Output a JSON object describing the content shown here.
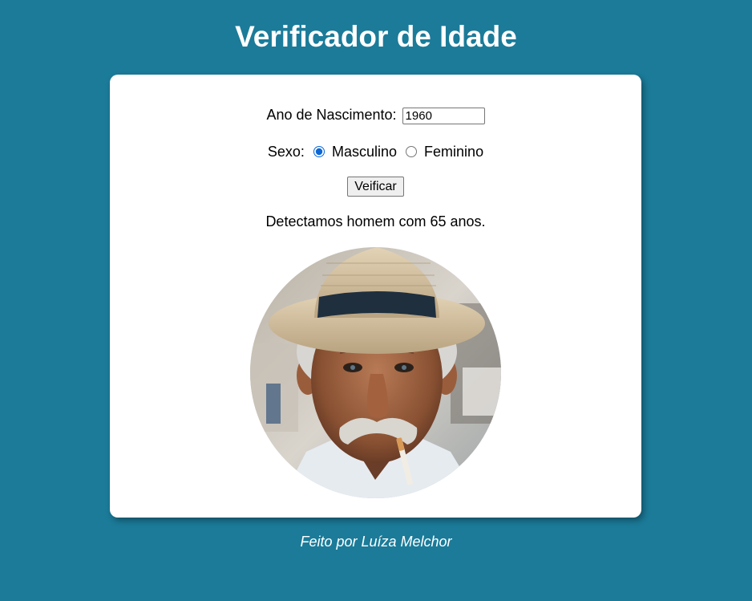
{
  "header": {
    "title": "Verificador de Idade"
  },
  "form": {
    "birth_label": "Ano de Nascimento:",
    "birth_value": "1960",
    "sex_label": "Sexo:",
    "sex_options": [
      {
        "label": "Masculino",
        "selected": true
      },
      {
        "label": "Feminino",
        "selected": false
      }
    ],
    "submit_label": "Veificar"
  },
  "result": {
    "text": "Detectamos homem com 65 anos.",
    "photo_icon": "elderly-man-photo"
  },
  "footer": {
    "credit": "Feito por Luíza Melchor"
  },
  "colors": {
    "background": "#1b7b99",
    "card": "#ffffff",
    "radio_accent": "#0b67d6"
  }
}
